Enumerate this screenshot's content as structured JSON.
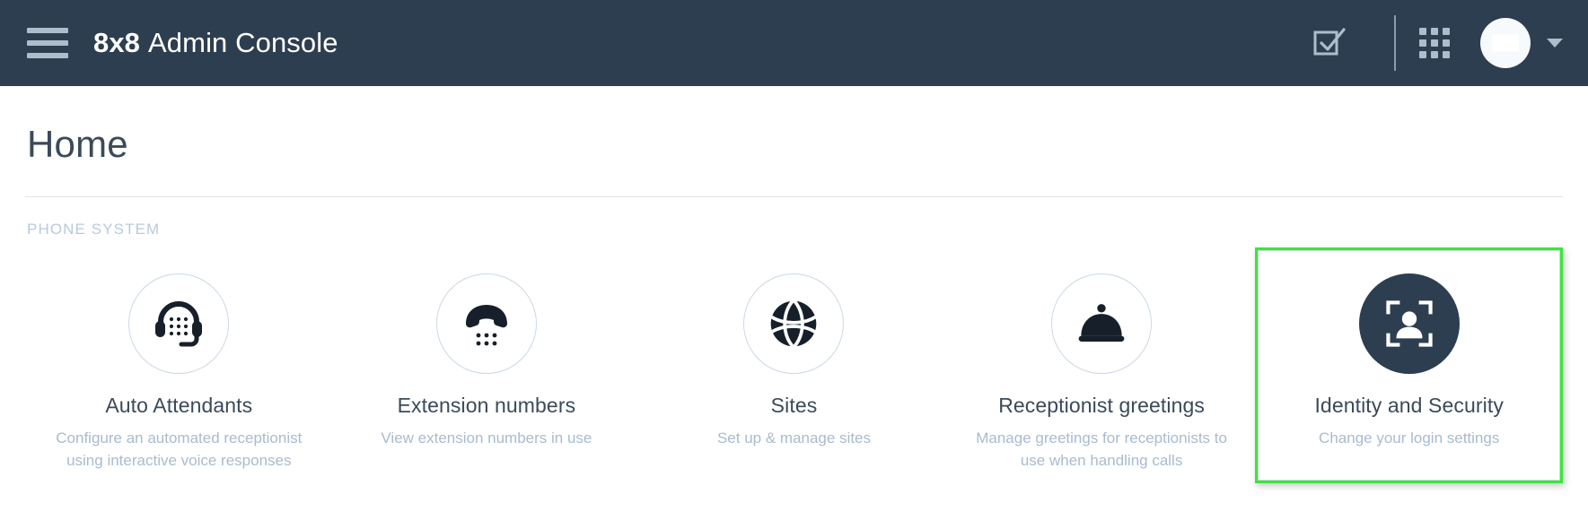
{
  "header": {
    "menu_icon": "hamburger-icon",
    "logo_text": "8x8",
    "app_title": "Admin Console",
    "tasks_icon": "checkbox-check-icon",
    "apps_icon": "app-grid-icon",
    "avatar_icon": "user-avatar",
    "caret_icon": "chevron-down-icon"
  },
  "page": {
    "title": "Home",
    "section_label": "PHONE SYSTEM"
  },
  "tiles": [
    {
      "id": "auto-attendants",
      "icon": "headset-keypad-icon",
      "title": "Auto Attendants",
      "description": "Configure an automated receptionist using interactive voice responses",
      "highlighted": false
    },
    {
      "id": "extension-numbers",
      "icon": "phone-handset-keypad-icon",
      "title": "Extension numbers",
      "description": "View extension numbers in use",
      "highlighted": false
    },
    {
      "id": "sites",
      "icon": "globe-icon",
      "title": "Sites",
      "description": "Set up & manage sites",
      "highlighted": false
    },
    {
      "id": "receptionist-greetings",
      "icon": "serving-dome-icon",
      "title": "Receptionist greetings",
      "description": "Manage greetings for receptionists to use when handling calls",
      "highlighted": false
    },
    {
      "id": "identity-and-security",
      "icon": "face-id-person-icon",
      "title": "Identity and Security",
      "description": "Change your login settings",
      "highlighted": true
    }
  ],
  "colors": {
    "topbar_bg": "#2d3e50",
    "accent_icon": "#aebdcd",
    "title_text": "#3b4a5a",
    "muted_text": "#a9bbd0",
    "section_label": "#b9cade",
    "highlight_border": "#3ae63a",
    "circle_border": "#ccd8e6"
  }
}
